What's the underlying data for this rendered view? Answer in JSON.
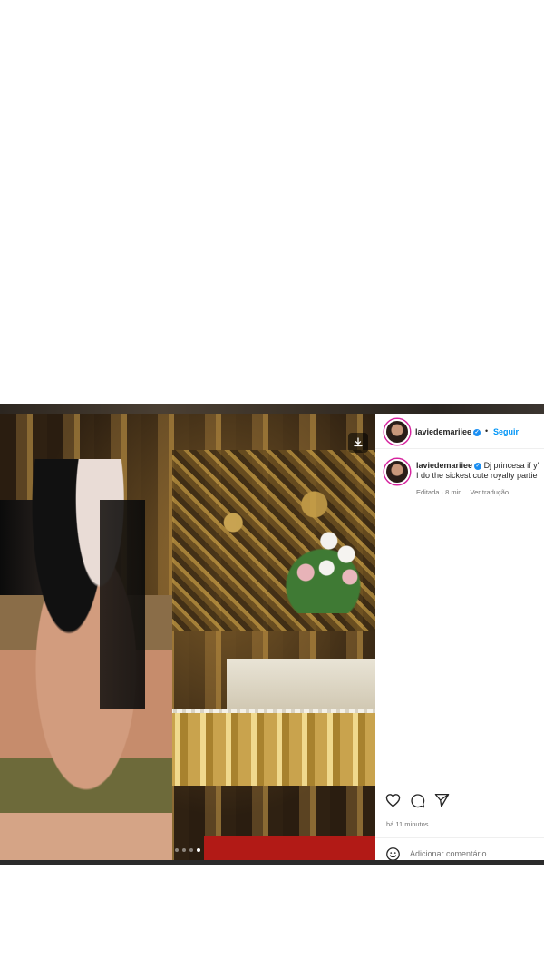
{
  "post": {
    "username": "laviedemariiee",
    "follow_label": "Seguir",
    "separator": "•",
    "caption_line1": "Dj princesa if y'",
    "caption_line2": "I do the sickest cute royalty partie",
    "edited_label": "Editada",
    "edited_time": "· 8 min",
    "translate_label": "Ver tradução",
    "posted_time": "há 11 minutos",
    "comment_placeholder": "Adicionar comentário...",
    "carousel": {
      "count": 4,
      "active_index": 3
    }
  },
  "icons": {
    "download": "download-icon",
    "like": "heart-icon",
    "comment": "comment-icon",
    "share": "send-icon",
    "emoji": "emoji-icon",
    "verified": "verified-badge-icon"
  },
  "colors": {
    "accent": "#0095f6",
    "verified": "#1a8ef2",
    "text": "#262626",
    "muted": "#737373"
  }
}
